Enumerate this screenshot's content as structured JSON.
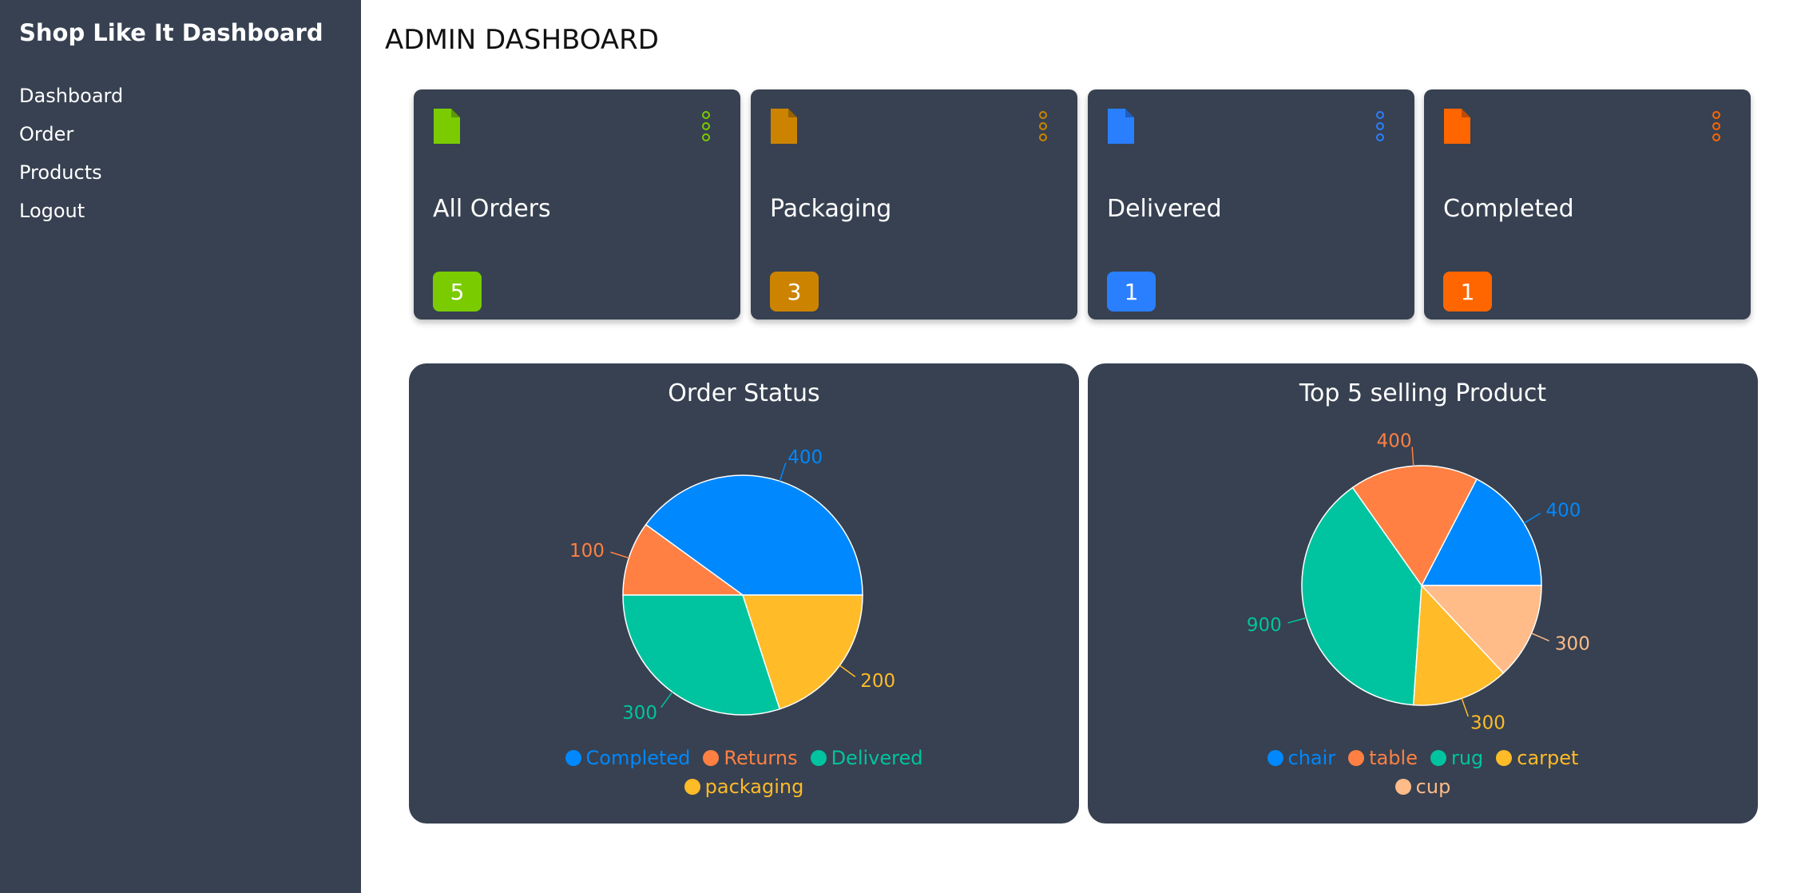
{
  "sidebar": {
    "brand": "Shop Like It Dashboard",
    "items": [
      {
        "label": "Dashboard"
      },
      {
        "label": "Order"
      },
      {
        "label": "Products"
      },
      {
        "label": "Logout"
      }
    ]
  },
  "header": {
    "title": "ADMIN DASHBOARD"
  },
  "cards": [
    {
      "title": "All Orders",
      "count": "5",
      "color": "#7ACC00",
      "icon": "file-icon",
      "menu_icon": "more-vertical-icon"
    },
    {
      "title": "Packaging",
      "count": "3",
      "color": "#CC8400",
      "icon": "file-icon",
      "menu_icon": "more-vertical-icon"
    },
    {
      "title": "Delivered",
      "count": "1",
      "color": "#2A7FFF",
      "icon": "file-icon",
      "menu_icon": "more-vertical-icon"
    },
    {
      "title": "Completed",
      "count": "1",
      "color": "#FF6600",
      "icon": "file-icon",
      "menu_icon": "more-vertical-icon"
    }
  ],
  "chart_data": [
    {
      "type": "pie",
      "title": "Order Status",
      "categories": [
        "Completed",
        "Returns",
        "Delivered",
        "packaging"
      ],
      "values": [
        400,
        100,
        300,
        200
      ],
      "data_labels": [
        "400",
        "100",
        "300",
        "200"
      ],
      "colors": [
        "#0088FE",
        "#FF8042",
        "#00C49F",
        "#FFBB28"
      ],
      "legend": "bottom"
    },
    {
      "type": "pie",
      "title": "Top 5 selling Product",
      "categories": [
        "chair",
        "table",
        "rug",
        "carpet",
        "cup"
      ],
      "values": [
        400,
        400,
        900,
        300,
        300
      ],
      "data_labels": [
        "400",
        "400",
        "900",
        "300",
        "300"
      ],
      "colors": [
        "#0088FE",
        "#FF8042",
        "#00C49F",
        "#FFBB28",
        "#FFBB88"
      ],
      "legend": "bottom"
    }
  ]
}
